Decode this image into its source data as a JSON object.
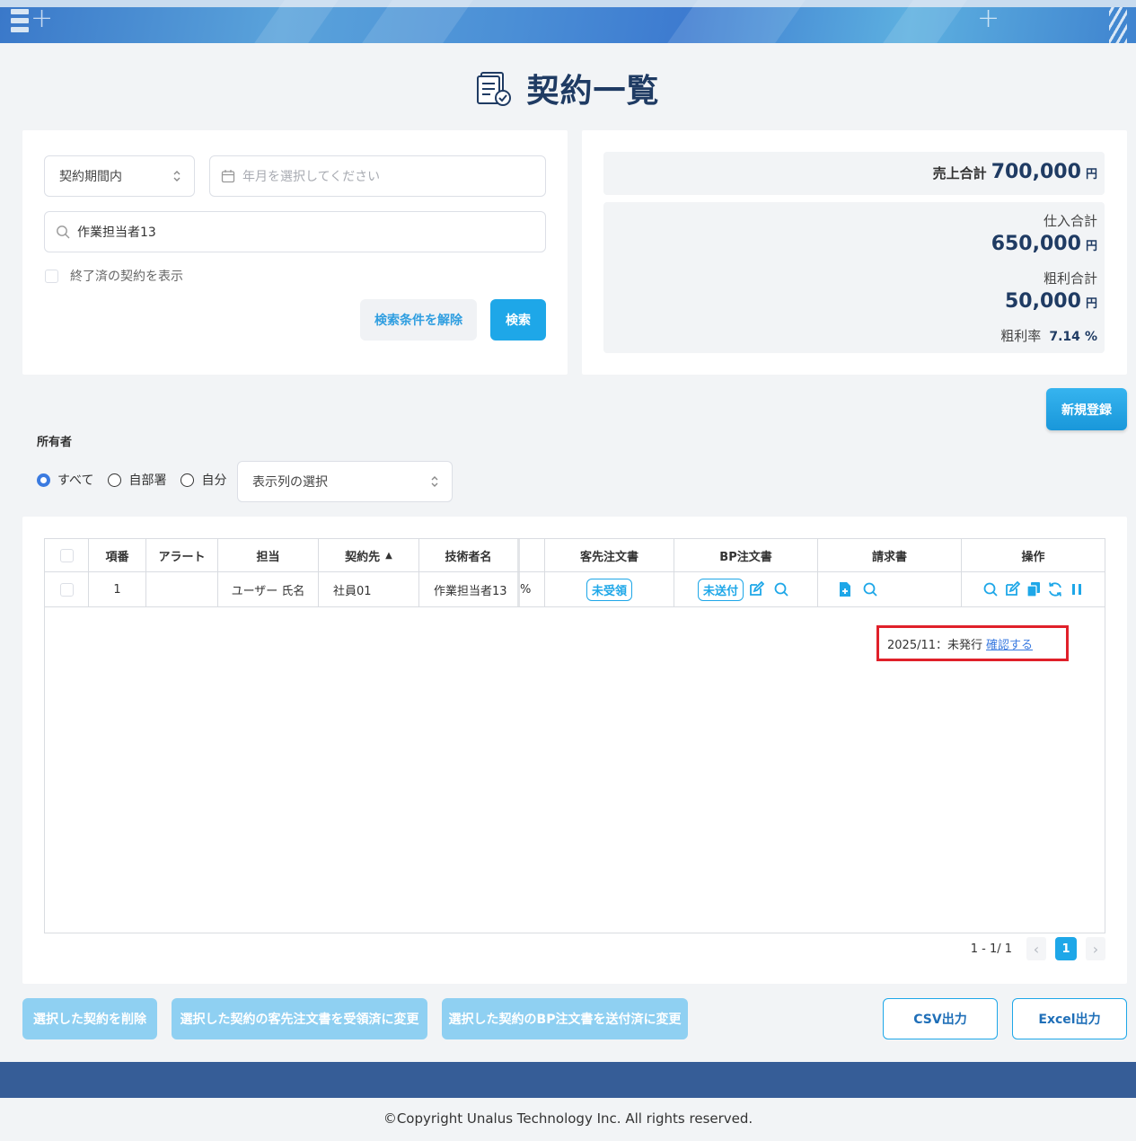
{
  "page": {
    "title": "契約一覧"
  },
  "search": {
    "period_select": "契約期間内",
    "month_placeholder": "年月を選択してください",
    "keyword_value": "作業担当者13",
    "show_finished_label": "終了済の契約を表示",
    "clear_label": "検索条件を解除",
    "search_label": "検索"
  },
  "summary": {
    "sales_label": "売上合計",
    "sales_value": "700,000",
    "purchase_label": "仕入合計",
    "purchase_value": "650,000",
    "profit_label": "粗利合計",
    "profit_value": "50,000",
    "rate_label": "粗利率",
    "rate_value": "7.14",
    "rate_unit": "%",
    "yen": "円"
  },
  "new_button": "新規登録",
  "owner": {
    "label": "所有者",
    "options": [
      "すべて",
      "自部署",
      "自分"
    ],
    "selected": "すべて",
    "column_select": "表示列の選択"
  },
  "table": {
    "headers": [
      "項番",
      "アラート",
      "担当",
      "契約先",
      "技術者名",
      "客先注文書",
      "BP注文書",
      "請求書",
      "操作"
    ],
    "sort_indicator": "▲",
    "row": {
      "no": "1",
      "alert": "",
      "assignee": "ユーザー 氏名",
      "client": "社員01",
      "engineer": "作業担当者13",
      "pct_fragment": "%",
      "client_order_status": "未受領",
      "bp_order_status": "未送付"
    },
    "popup": {
      "text": "2025/11：未発行",
      "link": "確認する"
    },
    "pager": {
      "range": "1 - 1/ 1",
      "current": "1"
    }
  },
  "bulk_actions": {
    "delete": "選択した契約を削除",
    "client_received": "選択した契約の客先注文書を受領済に変更",
    "bp_sent": "選択した契約のBP注文書を送付済に変更",
    "csv": "CSV出力",
    "excel": "Excel出力"
  },
  "footer": {
    "copyright": "©Copyright Unalus Technology Inc. All rights reserved."
  },
  "colors": {
    "accent": "#1ea7e8",
    "title": "#1f3b63",
    "footer": "#365d97",
    "highlight": "#e0202a"
  }
}
